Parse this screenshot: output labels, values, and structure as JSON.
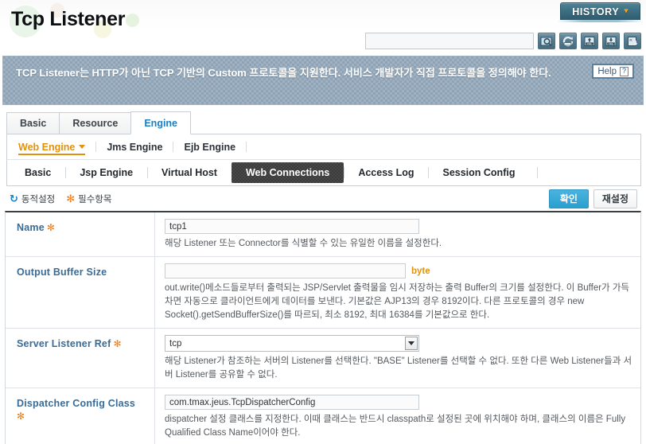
{
  "header": {
    "title": "Tcp Listener",
    "history_label": "HISTORY",
    "history_caret": "▾",
    "search_value": "",
    "search_placeholder": "",
    "toolbar_icons": [
      {
        "name": "search-icon"
      },
      {
        "name": "refresh-icon"
      },
      {
        "name": "xml-import-icon"
      },
      {
        "name": "xml-export-icon"
      },
      {
        "name": "resource-download-icon"
      }
    ]
  },
  "banner": {
    "text": "TCP Listener는 HTTP가 아닌 TCP 기반의 Custom 프로토콜을 지원한다. 서비스 개발자가 직접 프로토콜을 정의해야 한다.",
    "help_label": "Help",
    "help_mark": "?"
  },
  "tabs": [
    {
      "label": "Basic",
      "active": false
    },
    {
      "label": "Resource",
      "active": false
    },
    {
      "label": "Engine",
      "active": true
    }
  ],
  "engines": [
    {
      "label": "Web Engine",
      "selected": true
    },
    {
      "label": "Jms Engine",
      "selected": false
    },
    {
      "label": "Ejb Engine",
      "selected": false
    }
  ],
  "subtabs": [
    {
      "label": "Basic",
      "active": false
    },
    {
      "label": "Jsp Engine",
      "active": false
    },
    {
      "label": "Virtual Host",
      "active": false
    },
    {
      "label": "Web Connections",
      "active": true
    },
    {
      "label": "Access Log",
      "active": false
    },
    {
      "label": "Session Config",
      "active": false
    }
  ],
  "actionbar": {
    "dynamic_legend": "동적설정",
    "required_legend": "필수항목",
    "dynamic_icon": "↻",
    "required_icon": "✻",
    "confirm_label": "확인",
    "reset_label": "재설정"
  },
  "form": {
    "rows": [
      {
        "label": "Name",
        "required": true,
        "required_mark": "✻",
        "control": "text",
        "value": "tcp1",
        "unit": "",
        "desc": "해당 Listener 또는 Connector를 식별할 수 있는 유일한 이름을 설정한다."
      },
      {
        "label": "Output Buffer Size",
        "required": false,
        "required_mark": "",
        "control": "text",
        "value": "",
        "unit": "byte",
        "desc": "out.write()메소드들로부터 출력되는 JSP/Servlet 출력물을 임시 저장하는 출력 Buffer의 크기를 설정한다. 이 Buffer가 가득 차면 자동으로 클라이언트에게 데이터를 보낸다. 기본값은 AJP13의 경우 8192이다. 다른 프로토콜의 경우 new Socket().getSendBufferSize()를 따르되, 최소 8192, 최대 16384를 기본값으로 한다."
      },
      {
        "label": "Server Listener Ref",
        "required": true,
        "required_mark": "✻",
        "control": "select",
        "value": "tcp",
        "unit": "",
        "desc": "해당 Listener가 참조하는 서버의 Listener를 선택한다. \"BASE\" Listener를 선택할 수 없다. 또한 다른 Web Listener들과 서버 Listener를 공유할 수 없다."
      },
      {
        "label": "Dispatcher Config Class",
        "required": true,
        "required_mark": "✻",
        "control": "text",
        "value": "com.tmax.jeus.TcpDispatcherConfig",
        "unit": "",
        "desc": "dispatcher 설정 클래스를 지정한다. 이때 클래스는 반드시 classpath로 설정된 곳에 위치해야 하며, 클래스의 이름은 Fully Qualified Class Name이어야 한다."
      }
    ]
  },
  "colors": {
    "accent_blue": "#1a7fc1",
    "label_blue": "#3a6b96",
    "required_orange": "#f07c1a",
    "engine_orange": "#e1920c",
    "history_teal": "#3d6f83",
    "banner_slate": "#8ea3b5",
    "active_subtab": "#3b3b3b"
  }
}
